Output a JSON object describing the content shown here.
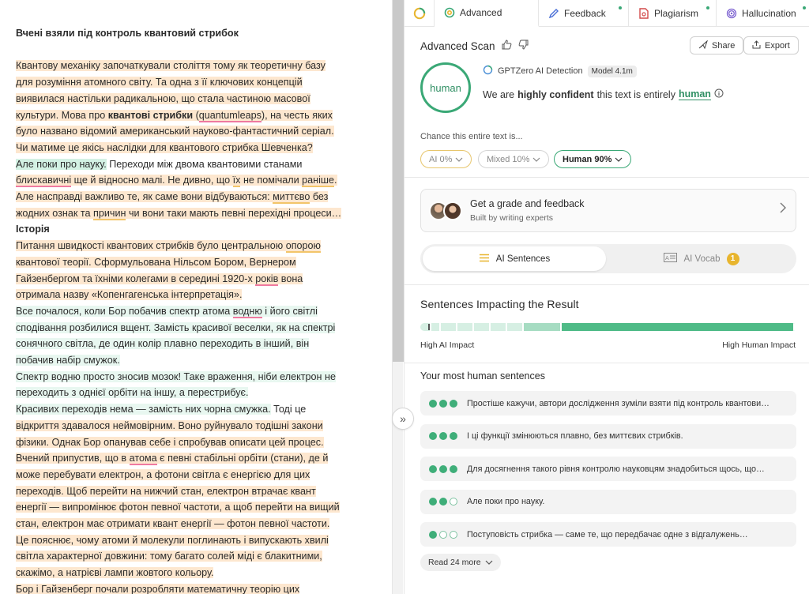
{
  "document": {
    "title": "Вчені взяли під контроль квантовий стрибок",
    "lines": [
      [
        {
          "t": "Квантову механіку започаткували століття тому як теоретичну базу",
          "c": "hl-o"
        }
      ],
      [
        {
          "t": "для розуміння атомного світу. Та одна з її ключових концепцій",
          "c": "hl-o"
        }
      ],
      [
        {
          "t": "виявилася настільки радикальною, що стала частиною масової",
          "c": "hl-o"
        }
      ],
      [
        {
          "t": "культури. Мова про ",
          "c": "hl-o"
        },
        {
          "t": "квантові стрибки",
          "c": "hl-o bold"
        },
        {
          "t": " (",
          "c": "hl-o"
        },
        {
          "t": "quantumleaps",
          "c": "hl-o und-r"
        },
        {
          "t": "), на честь яких",
          "c": "hl-o"
        }
      ],
      [
        {
          "t": "було названо відомий американський науково-фантастичний серіал.",
          "c": "hl-o"
        }
      ],
      [
        {
          "t": "Чи матиме це якісь наслідки для квантового стрибка Шевченка?",
          "c": "hl-o"
        }
      ],
      [
        {
          "t": "Але поки про науку.",
          "c": "hl-g"
        },
        {
          "t": " Переходи між двома квантовими станами",
          "c": ""
        }
      ],
      [
        {
          "t": "блискавичні",
          "c": "hl-o und-r"
        },
        {
          "t": " ще й відносно малі. ",
          "c": "hl-o"
        },
        {
          "t": "Не дивно, що ",
          "c": "hl-o"
        },
        {
          "t": "їх",
          "c": "hl-o und-y"
        },
        {
          "t": " не помічали ",
          "c": "hl-o"
        },
        {
          "t": "раніше",
          "c": "hl-o und-y"
        },
        {
          "t": ".",
          "c": "hl-o"
        }
      ],
      [
        {
          "t": "Але насправді важливо те, як саме вони відбуваються: ",
          "c": "hl-o"
        },
        {
          "t": "миттєво",
          "c": "hl-o und-y"
        },
        {
          "t": " без",
          "c": "hl-o"
        }
      ],
      [
        {
          "t": "жодних ознак та ",
          "c": "hl-o"
        },
        {
          "t": "причин",
          "c": "hl-o und-y"
        },
        {
          "t": " чи вони таки мають певні перехідні процеси…",
          "c": "hl-o"
        }
      ],
      [
        {
          "t": "Історія",
          "c": "bold"
        }
      ],
      [
        {
          "t": "Питання швидкості квантових стрибків було центральною ",
          "c": "hl-o"
        },
        {
          "t": "опорою",
          "c": "hl-o und-y"
        }
      ],
      [
        {
          "t": "квантової теорії. Сформульована Нільсом Бором, Вернером",
          "c": "hl-o"
        }
      ],
      [
        {
          "t": "Гайзенбергом та їхніми колегами в середині 1920-х ",
          "c": "hl-o"
        },
        {
          "t": "років",
          "c": "hl-o und-r"
        },
        {
          "t": " вона",
          "c": "hl-o"
        }
      ],
      [
        {
          "t": "отримала назву «Копенгагенська інтерпретація».",
          "c": "hl-o"
        }
      ],
      [
        {
          "t": "Все почалося, коли Бор побачив спектр атома ",
          "c": "hl-lg"
        },
        {
          "t": "водню",
          "c": "hl-lg und-r"
        },
        {
          "t": " і його світлі",
          "c": "hl-lg"
        }
      ],
      [
        {
          "t": "сподівання розбилися вщент. Замість красивої веселки, як на спектрі",
          "c": "hl-lg"
        }
      ],
      [
        {
          "t": "сонячного світла, де один колір плавно переходить в інший, він",
          "c": "hl-lg"
        }
      ],
      [
        {
          "t": "побачив набір смужок.",
          "c": "hl-lg"
        }
      ],
      [
        {
          "t": "Спектр водню просто зносив мозок! Таке враження, ніби електрон не",
          "c": "hl-lg"
        }
      ],
      [
        {
          "t": "переходить з однієї орбіти на іншу, а перестрибує.",
          "c": "hl-lg"
        }
      ],
      [
        {
          "t": "Красивих переходів нема — замість них чорна смужка.",
          "c": "hl-lg"
        },
        {
          "t": " Тоді це",
          "c": ""
        }
      ],
      [
        {
          "t": "відкриття здавалося неймовірним. ",
          "c": "hl-o"
        },
        {
          "t": "Воно руйнувало тодішні закони",
          "c": "hl-o"
        }
      ],
      [
        {
          "t": "фізики. Однак Бор опанував себе і спробував описати цей процес.",
          "c": "hl-o"
        }
      ],
      [
        {
          "t": "Вчений припустив, що в ",
          "c": "hl-o"
        },
        {
          "t": "атома",
          "c": "hl-o und-r"
        },
        {
          "t": " є певні стабільні орбіти (стани), де й",
          "c": "hl-o"
        }
      ],
      [
        {
          "t": "може перебувати електрон, а фотони світла є енергією для цих",
          "c": "hl-o"
        }
      ],
      [
        {
          "t": "переходів. Щоб перейти на нижчий стан, електрон втрачає квант",
          "c": "hl-o"
        }
      ],
      [
        {
          "t": "енергії — випромінює фотон певної частоти, а щоб перейти на вищий",
          "c": "hl-o"
        }
      ],
      [
        {
          "t": "стан, електрон має отримати квант енергії — фотон певної частоти.",
          "c": "hl-o"
        }
      ],
      [
        {
          "t": "Це пояснює, чому атоми й молекули поглинають і випускають хвилі",
          "c": "hl-o"
        }
      ],
      [
        {
          "t": "світла характерної довжини: тому багато солей міді є блакитними,",
          "c": "hl-o"
        }
      ],
      [
        {
          "t": "скажімо, а натрієві лампи жовтого кольору.",
          "c": "hl-o"
        }
      ],
      [
        {
          "t": "Бор і Гайзенберг почали розробляти математичну теорію цих",
          "c": "hl-o"
        }
      ]
    ]
  },
  "tabs": [
    {
      "label": "Advanced",
      "icon": "advanced-scan-icon",
      "active": true,
      "dot": false
    },
    {
      "label": "Feedback",
      "icon": "feedback-pen-icon",
      "active": false,
      "dot": true
    },
    {
      "label": "Plagiarism",
      "icon": "plagiarism-doc-icon",
      "active": false,
      "dot": true
    },
    {
      "label": "Hallucination",
      "icon": "hallucination-fingerprint-icon",
      "active": false,
      "dot": true
    }
  ],
  "scan": {
    "title": "Advanced Scan",
    "share_label": "Share",
    "export_label": "Export",
    "verdict": "human",
    "detector_name": "GPTZero AI Detection",
    "model_badge": "Model 4.1m",
    "confidence_prefix": "We are",
    "confidence_strong": "highly confident",
    "confidence_middle": "this text is entirely",
    "confidence_verdict": "human",
    "chance_label": "Chance this entire text is...",
    "pills": {
      "ai": "AI 0%",
      "mixed": "Mixed 10%",
      "human": "Human 90%"
    }
  },
  "grade": {
    "title": "Get a grade and feedback",
    "subtitle": "Built by writing experts"
  },
  "toggle": {
    "left_label": "AI Sentences",
    "right_label": "AI Vocab",
    "vocab_count": "1"
  },
  "impact": {
    "title": "Sentences Impacting the Result",
    "low_label": "High AI Impact",
    "high_label": "High Human Impact",
    "segments": [
      {
        "share": 0.03,
        "color": "#d6efe3"
      },
      {
        "share": 0.025,
        "color": "#d6efe3"
      },
      {
        "share": 0.045,
        "color": "#d6efe3"
      },
      {
        "share": 0.045,
        "color": "#d6efe3"
      },
      {
        "share": 0.045,
        "color": "#d6efe3"
      },
      {
        "share": 0.045,
        "color": "#d6efe3"
      },
      {
        "share": 0.045,
        "color": "#d6efe3"
      },
      {
        "share": 0.1,
        "color": "#a6dcc2"
      },
      {
        "share": 0.62,
        "color": "#4fbb87"
      }
    ],
    "marker_position": 0.02
  },
  "most_human": {
    "title": "Your most human sentences",
    "sentences": [
      {
        "text": "Простіше кажучи, автори дослідження зуміли взяти під контроль квантови…",
        "level": 3
      },
      {
        "text": "І ці функції змінюються плавно, без миттєвих стрибків.",
        "level": 3
      },
      {
        "text": "Для досягнення такого рівня контролю науковцям знадобиться щось, що…",
        "level": 3
      },
      {
        "text": "Але поки про науку.",
        "level": 2
      },
      {
        "text": "Поступовість стрибка — саме те, що передбачає одне з відгалужень…",
        "level": 1
      }
    ],
    "read_more": "Read 24 more"
  },
  "colors": {
    "accent_green": "#3aa876",
    "ai_yellow": "#e7c66d",
    "highlight_orange": "#fde7cf",
    "highlight_green": "#d3f1e3"
  }
}
